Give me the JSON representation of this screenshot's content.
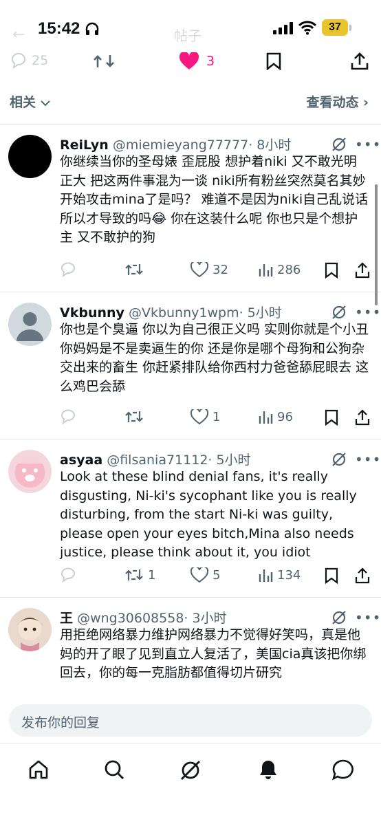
{
  "status_bar": {
    "time": "15:42",
    "battery": "37"
  },
  "header": {
    "ghost_title": "帖子"
  },
  "tweet_actions": {
    "reply_count": "25",
    "like_count": "3"
  },
  "related": {
    "label": "相关",
    "activity_label": "查看动态"
  },
  "replies": [
    {
      "name": "ReiLyn",
      "handle": "@miemieyang77777",
      "time": "· 8小时",
      "text": "你继续当你的圣母婊 歪屁股 想护着niki 又不敢光明正大 把这两件事混为一谈 niki所有粉丝突然莫名其妙开始攻击mina了是吗？ 难道不是因为niki自己乱说话 所以才导致的吗😂 你在这装什么呢 你也只是个想护主 又不敢护的狗",
      "reply_count": "",
      "retweet_count": "",
      "like_count": "32",
      "view_count": "286"
    },
    {
      "name": "Vkbunny",
      "handle": "@Vkbunny1wpm",
      "time": "· 5小时",
      "text": "你也是个臭逼 你以为自己很正义吗 实则你就是个小丑 你妈妈是不是卖逼生的你 还是你是哪个母狗和公狗杂交出来的畜生 你赶紧排队给你西村力爸爸舔屁眼去 这么鸡巴会舔",
      "reply_count": "",
      "retweet_count": "",
      "like_count": "1",
      "view_count": "96"
    },
    {
      "name": "asyaa",
      "handle": "@filsania71112",
      "time": "· 5小时",
      "text": "Look at these blind denial fans, it's really disgusting, Ni-ki's sycophant like you is really disturbing, from the start Ni-ki was guilty, please open your eyes bitch,Mina also needs justice, please think about it, you idiot",
      "reply_count": "",
      "retweet_count": "1",
      "like_count": "5",
      "view_count": "134"
    },
    {
      "name": "王",
      "handle": "@wng30608558",
      "time": "· 3小时",
      "text": "用拒绝网络暴力维护网络暴力不觉得好笑吗，真是他妈的开了眼了见到直立人复活了，美国cia真该把你绑回去，你的每一克脂肪都值得切片研究"
    }
  ],
  "compose": {
    "placeholder": "发布你的回复"
  },
  "colors": {
    "like_active": "#f91880",
    "text_secondary": "#536471",
    "battery": "#e8c42d"
  },
  "bottom_nav": [
    "home-icon",
    "search-icon",
    "grok-icon",
    "notifications-icon",
    "messages-icon"
  ]
}
